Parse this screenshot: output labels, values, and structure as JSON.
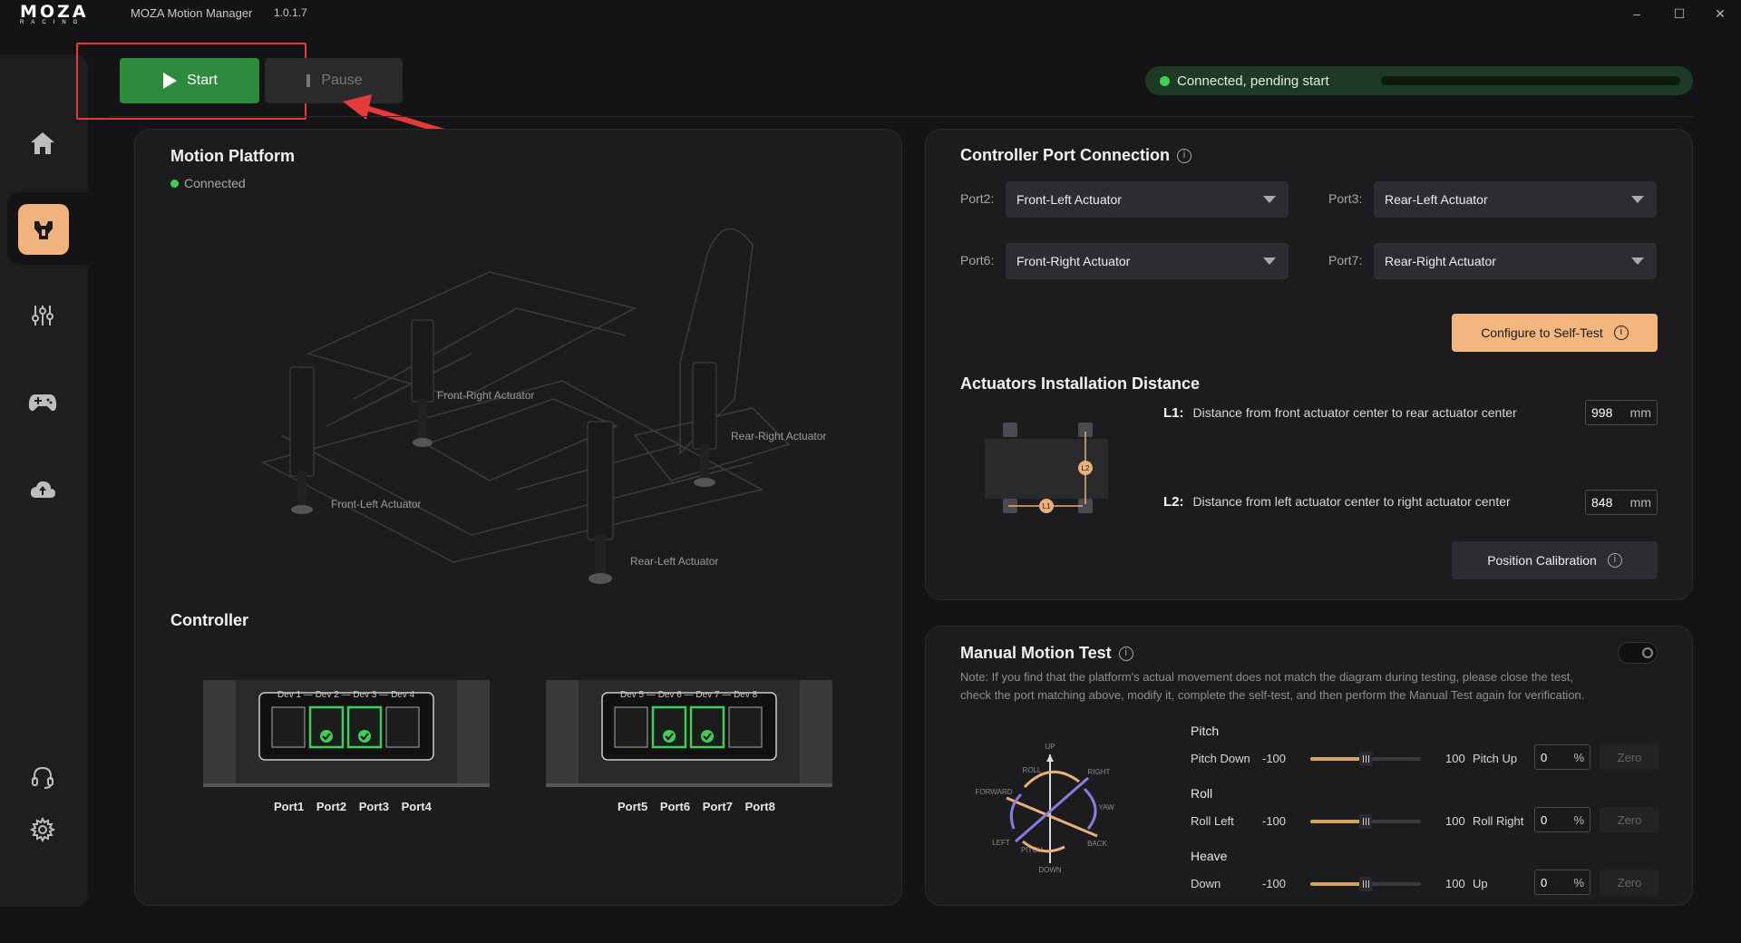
{
  "app": {
    "logo_top": "MOZA",
    "logo_bottom": "RACING",
    "title": "MOZA Motion Manager",
    "version": "1.0.1.7"
  },
  "window_controls": {
    "minimize": "–",
    "maximize": "☐",
    "close": "✕"
  },
  "sidebar": {
    "items": [
      {
        "name": "home-icon",
        "active": false
      },
      {
        "name": "motion-icon",
        "active": true
      },
      {
        "name": "tuning-icon",
        "active": false
      },
      {
        "name": "gamepad-icon",
        "active": false
      },
      {
        "name": "cloud-icon",
        "active": false
      },
      {
        "name": "support-icon",
        "active": false
      },
      {
        "name": "settings-icon",
        "active": false
      }
    ]
  },
  "toolbar": {
    "start_label": "Start",
    "pause_label": "Pause",
    "status_text": "Connected, pending start",
    "accent_green": "#2e8b3e"
  },
  "motion_platform": {
    "title": "Motion Platform",
    "status": "Connected",
    "actuators": {
      "front_right": "Front-Right Actuator",
      "rear_right": "Rear-Right Actuator",
      "front_left": "Front-Left Actuator",
      "rear_left": "Rear-Left Actuator"
    },
    "controller_title": "Controller",
    "controller_left": {
      "devs": [
        "Dev 1",
        "Dev 2",
        "Dev 3",
        "Dev 4"
      ],
      "ports": [
        "Port1",
        "Port2",
        "Port3",
        "Port4"
      ],
      "connected": [
        false,
        true,
        true,
        false
      ]
    },
    "controller_right": {
      "devs": [
        "Dev 5",
        "Dev 6",
        "Dev 7",
        "Dev 8"
      ],
      "ports": [
        "Port5",
        "Port6",
        "Port7",
        "Port8"
      ],
      "connected": [
        false,
        true,
        true,
        false
      ]
    }
  },
  "port_connection": {
    "title": "Controller Port Connection",
    "port2_label": "Port2:",
    "port2_value": "Front-Left Actuator",
    "port3_label": "Port3:",
    "port3_value": "Rear-Left Actuator",
    "port6_label": "Port6:",
    "port6_value": "Front-Right Actuator",
    "port7_label": "Port7:",
    "port7_value": "Rear-Right Actuator",
    "self_test_label": "Configure to Self-Test"
  },
  "installation": {
    "title": "Actuators Installation Distance",
    "l1_key": "L1:",
    "l1_text": "Distance from front actuator center to rear actuator center",
    "l1_value": "998",
    "l2_key": "L2:",
    "l2_text": "Distance from left actuator center to right actuator center",
    "l2_value": "848",
    "unit": "mm",
    "diagram_l1": "L1",
    "diagram_l2": "L2",
    "calibration_label": "Position Calibration"
  },
  "manual_test": {
    "title": "Manual Motion Test",
    "note": "Note: If you find that the platform's actual movement does not match the diagram during testing, please close the test, check the port matching above, modify it, complete the self-test, and then perform the Manual Test again for verification.",
    "diagram_labels": {
      "up": "UP",
      "down": "DOWN",
      "roll": "ROLL",
      "right": "RIGHT",
      "forward": "FORWARD",
      "yaw": "YAW",
      "left": "LEFT",
      "pitch": "PITCH",
      "back": "BACK"
    },
    "axes": [
      {
        "title": "Pitch",
        "min_label": "Pitch Down",
        "min": "-100",
        "max": "100",
        "max_label": "Pitch Up",
        "value": "0",
        "unit": "%",
        "zero": "Zero"
      },
      {
        "title": "Roll",
        "min_label": "Roll Left",
        "min": "-100",
        "max": "100",
        "max_label": "Roll Right",
        "value": "0",
        "unit": "%",
        "zero": "Zero"
      },
      {
        "title": "Heave",
        "min_label": "Down",
        "min": "-100",
        "max": "100",
        "max_label": "Up",
        "value": "0",
        "unit": "%",
        "zero": "Zero"
      }
    ]
  }
}
